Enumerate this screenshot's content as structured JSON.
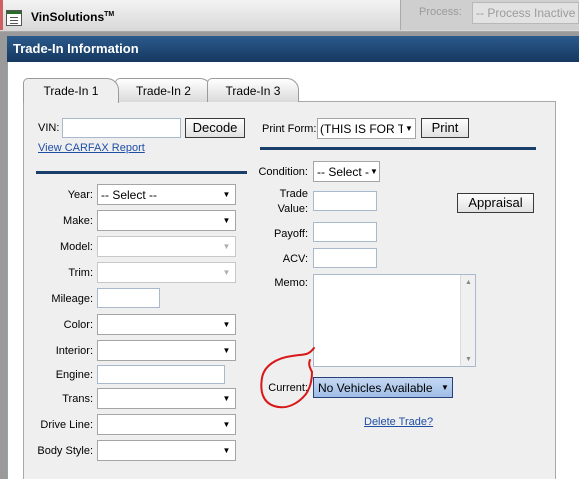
{
  "window": {
    "app_title": "VinSolutions",
    "app_title_tm": "TM",
    "background_process_label": "Process:",
    "background_process_value": "-- Process Inactive --"
  },
  "header": {
    "title": "Trade-In Information"
  },
  "tabs": [
    {
      "label": "Trade-In 1",
      "active": true
    },
    {
      "label": "Trade-In 2",
      "active": false
    },
    {
      "label": "Trade-In 3",
      "active": false
    }
  ],
  "left": {
    "vin_label": "VIN:",
    "vin_value": "",
    "decode_button": "Decode",
    "carfax_link": "View CARFAX Report",
    "fields": {
      "year": {
        "label": "Year:",
        "value": "-- Select --"
      },
      "make": {
        "label": "Make:",
        "value": ""
      },
      "model": {
        "label": "Model:",
        "value": ""
      },
      "trim": {
        "label": "Trim:",
        "value": ""
      },
      "mileage": {
        "label": "Mileage:",
        "value": ""
      },
      "color": {
        "label": "Color:",
        "value": ""
      },
      "interior": {
        "label": "Interior:",
        "value": ""
      },
      "engine": {
        "label": "Engine:",
        "value": ""
      },
      "trans": {
        "label": "Trans:",
        "value": ""
      },
      "drive_line": {
        "label": "Drive Line:",
        "value": ""
      },
      "body_style": {
        "label": "Body Style:",
        "value": ""
      }
    }
  },
  "right": {
    "print_form_label": "Print Form:",
    "print_form_value": "(THIS IS FOR TE",
    "print_button": "Print",
    "condition_label": "Condition:",
    "condition_value": "-- Select --",
    "trade_value_label_1": "Trade",
    "trade_value_label_2": "Value:",
    "appraisal_button": "Appraisal",
    "payoff_label": "Payoff:",
    "acv_label": "ACV:",
    "memo_label": "Memo:",
    "current_label": "Current:",
    "current_value": "No Vehicles Available",
    "delete_link": "Delete Trade?"
  },
  "colors": {
    "header_bar": "#1f4a78",
    "link": "#1f4fa4",
    "annotation_red": "#d81818"
  }
}
